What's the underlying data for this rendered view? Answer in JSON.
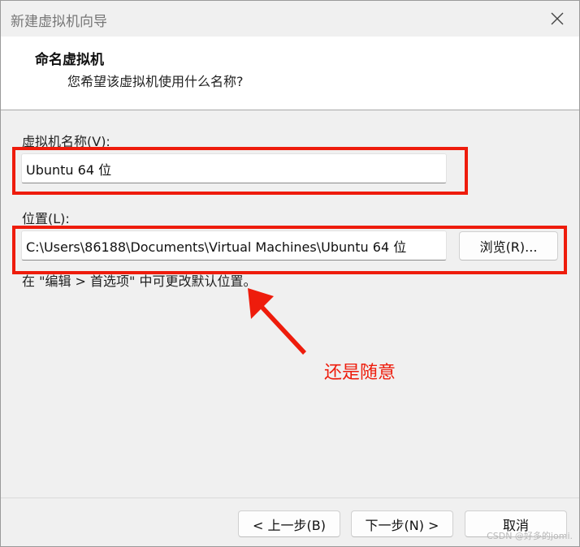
{
  "window": {
    "title": "新建虚拟机向导",
    "close_icon": "close-icon"
  },
  "header": {
    "title": "命名虚拟机",
    "subtitle": "您希望该虚拟机使用什么名称?"
  },
  "form": {
    "name_label": "虚拟机名称(V):",
    "name_value": "Ubuntu 64 位",
    "location_label": "位置(L):",
    "location_value": "C:\\Users\\86188\\Documents\\Virtual Machines\\Ubuntu 64 位",
    "browse_button": "浏览(R)...",
    "hint": "在 \"编辑 > 首选项\" 中可更改默认位置。"
  },
  "annotation": {
    "text": "还是随意",
    "color": "#ee1c0c"
  },
  "footer": {
    "back_button": "< 上一步(B)",
    "next_button": "下一步(N) >",
    "cancel_button": "取消"
  },
  "watermark": "CSDN @好多的jomi."
}
